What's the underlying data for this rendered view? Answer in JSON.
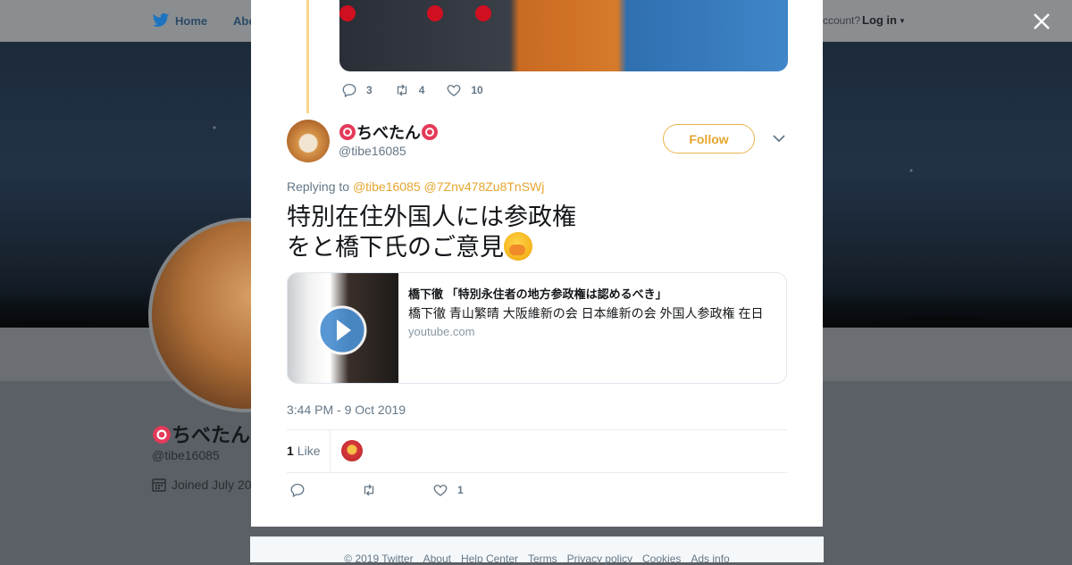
{
  "background_page": {
    "nav": {
      "home_label": "Home",
      "about_label": "Abo",
      "account_text": "ccount?",
      "login_label": "Log in"
    },
    "profile": {
      "name": "ちべたん",
      "handle": "@tibe16085",
      "joined": "Joined July 20"
    }
  },
  "modal": {
    "previous_tweet": {
      "reply_count": "3",
      "retweet_count": "4",
      "like_count": "10"
    },
    "tweet": {
      "author_name": "ちべたん",
      "author_handle": "@tibe16085",
      "follow_label": "Follow",
      "replying_prefix": "Replying to",
      "replying_mentions": [
        "@tibe16085",
        "@7Znv478Zu8TnSWj"
      ],
      "text_line1": "特別在住外国人には参政権",
      "text_line2": "をと橋下氏のご意見",
      "card": {
        "title": "橋下徹 「特別永住者の地方参政権は認めるべき」",
        "description": "橋下徹 青山繁晴 大阪維新の会 日本維新の会 外国人参政権 在日",
        "domain": "youtube.com"
      },
      "timestamp": "3:44 PM - 9 Oct 2019",
      "like_stat_count": "1",
      "like_stat_label": "Like",
      "action_like_count": "1"
    }
  },
  "footer": {
    "links": [
      "© 2019 Twitter",
      "About",
      "Help Center",
      "Terms",
      "Privacy policy",
      "Cookies",
      "Ads info"
    ]
  },
  "colors": {
    "accent": "#e5a52f",
    "thread_line": "#fad88a",
    "secondary_text": "#657786"
  },
  "icons": [
    "twitter-bird-icon",
    "close-icon",
    "reply-icon",
    "retweet-icon",
    "heart-icon",
    "chevron-down-icon",
    "play-icon",
    "calendar-icon",
    "flower-emoji-icon",
    "face-emoji-icon"
  ]
}
